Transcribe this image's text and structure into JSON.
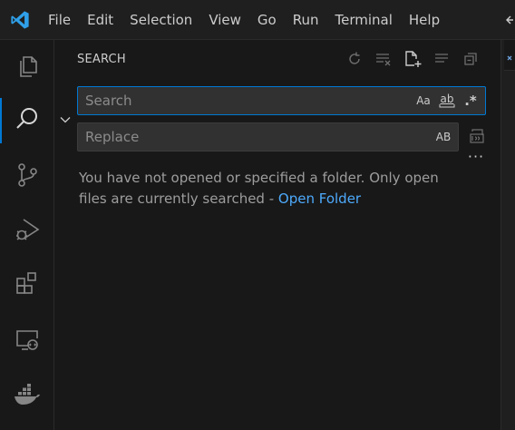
{
  "menu": [
    "File",
    "Edit",
    "Selection",
    "View",
    "Go",
    "Run",
    "Terminal",
    "Help"
  ],
  "activity": [
    "explorer-icon",
    "search-icon",
    "source-control-icon",
    "run-debug-icon",
    "extensions-icon",
    "remote-explorer-icon",
    "docker-icon"
  ],
  "sidebar": {
    "title": "SEARCH",
    "search": {
      "placeholder": "Search",
      "value": "",
      "opt_case": "Aa",
      "opt_word": "ab",
      "opt_regex": ".*"
    },
    "replace": {
      "placeholder": "Replace",
      "value": "",
      "opt_preserve_case": "AB"
    },
    "message": "You have not opened or specified a folder. Only open files are currently searched - ",
    "link": "Open Folder"
  },
  "colors": {
    "accent": "#0078d4",
    "link": "#4daafc",
    "logo": "#2f9fe8"
  }
}
